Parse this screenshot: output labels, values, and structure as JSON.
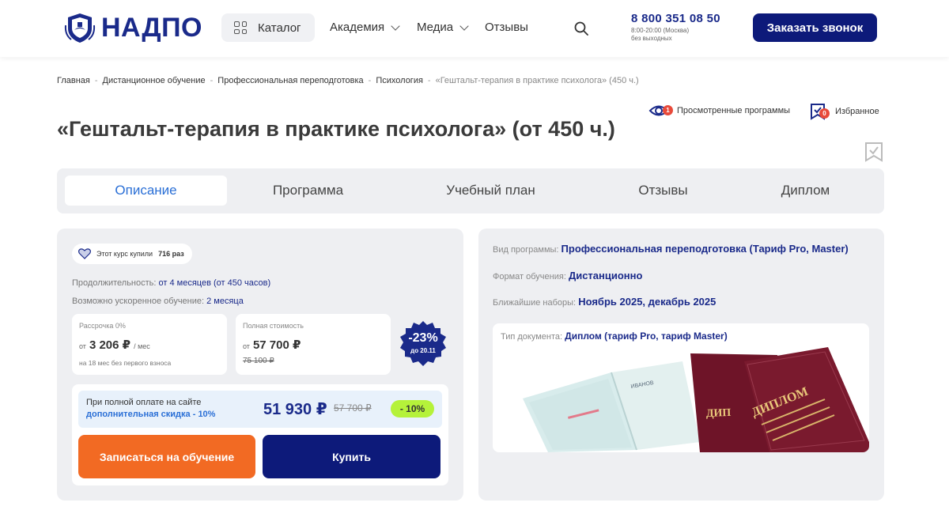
{
  "header": {
    "logo_text": "НАДПО",
    "catalog_label": "Каталог",
    "nav": [
      "Академия",
      "Медиа",
      "Отзывы"
    ],
    "phone": "8 800 351 08 50",
    "hours": "8:00-20:00 (Москва)",
    "days": "без выходных",
    "call_button": "Заказать звонок"
  },
  "breadcrumb": [
    "Главная",
    "Дистанционное обучение",
    "Профессиональная переподготовка",
    "Психология",
    "«Гештальт-терапия в практике психолога» (450 ч.)"
  ],
  "viewed": {
    "label": "Просмотренные программы",
    "count": "1"
  },
  "favorites": {
    "label": "Избранное",
    "count": "0"
  },
  "title": "«Гештальт-терапия в практике психолога» (от 450 ч.)",
  "tabs": [
    "Описание",
    "Программа",
    "Учебный план",
    "Отзывы",
    "Диплом"
  ],
  "course": {
    "bought_prefix": "Этот курс купили",
    "bought_count": "716 раз",
    "duration_label": "Продолжительность:",
    "duration_value": "от 4 месяцев (от 450 часов)",
    "accel_label": "Возможно ускоренное обучение:",
    "accel_value": "2 месяца",
    "installment_label": "Рассрочка 0%",
    "installment_from": "от",
    "installment_price": "3 206 ₽",
    "installment_unit": "/ мес",
    "installment_sub": "на 18 мес без первого взноса",
    "full_label": "Полная стоимость",
    "full_from": "от",
    "full_price": "57 700 ₽",
    "full_old": "75 100 ₽",
    "discount_pct": "-23%",
    "discount_until": "до 20.11",
    "pay_line1": "При полной оплате на сайте",
    "pay_line2": "дополнительная скидка - 10%",
    "pay_price": "51 930 ₽",
    "pay_old": "57 700 ₽",
    "pay_tag": "- 10%",
    "enroll_button": "Записаться на обучение",
    "buy_button": "Купить"
  },
  "details": {
    "type_label": "Вид программы:",
    "type_value": "Профессиональная переподготовка (Тариф Pro, Master)",
    "format_label": "Формат обучения:",
    "format_value": "Дистанционно",
    "start_label": "Ближайшие наборы:",
    "start_value": "Ноябрь 2025, декабрь 2025",
    "doc_label": "Тип документа:",
    "doc_value": "Диплом (тариф Pro, тариф Master)",
    "diploma_cover_title": "ДИПЛОМ"
  },
  "colors": {
    "brand": "#1a2a8a",
    "accent_orange": "#f26a23",
    "accent_blue": "#2a6fd6",
    "lime": "#b5f23a",
    "maroon": "#7a1a2e"
  }
}
